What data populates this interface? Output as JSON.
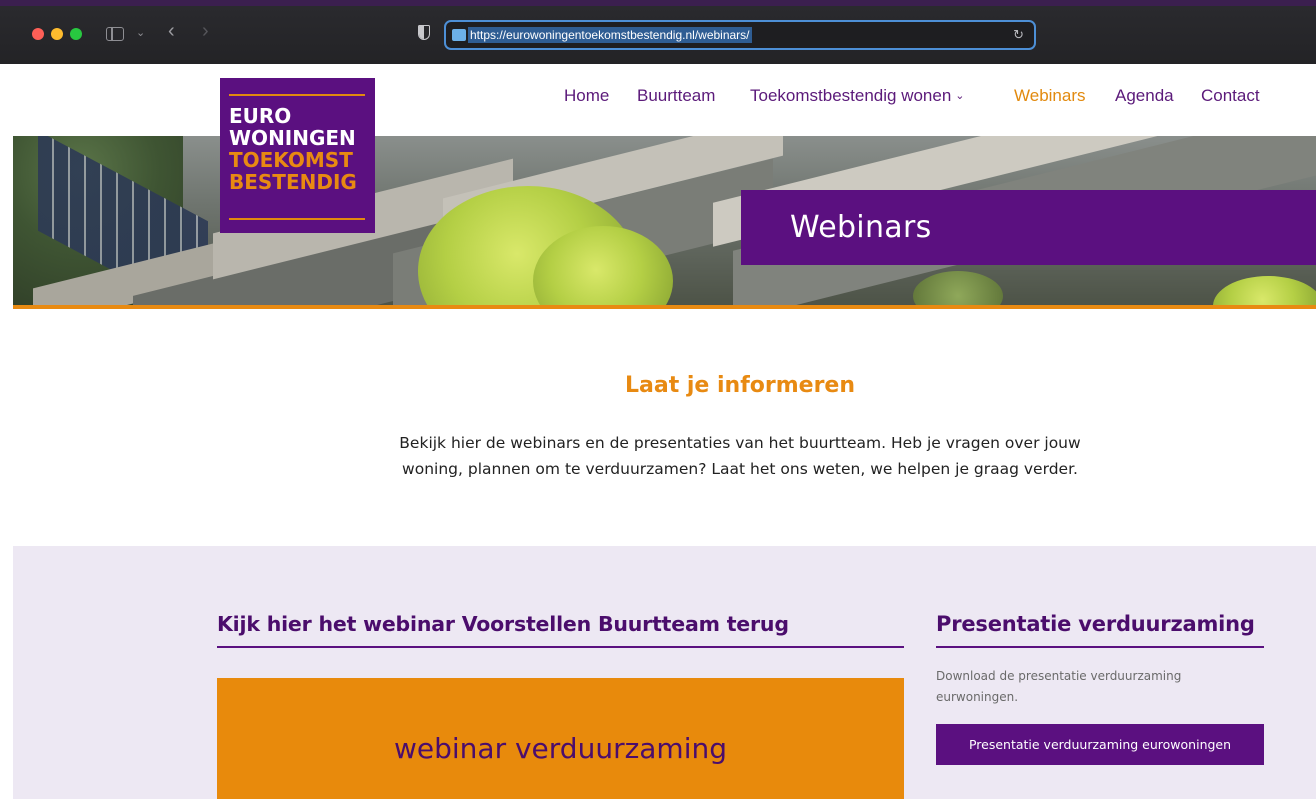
{
  "browser": {
    "url": "https://eurowoningentoekomstbestendig.nl/webinars/"
  },
  "logo": {
    "line1": "EURO",
    "line2": "WONINGEN",
    "line3": "TOEKOMST",
    "line4": "BESTENDIG"
  },
  "nav": {
    "items": [
      {
        "label": "Home"
      },
      {
        "label": "Buurtteam"
      },
      {
        "label": "Toekomstbestendig wonen"
      },
      {
        "label": "Webinars",
        "active": true
      },
      {
        "label": "Agenda"
      },
      {
        "label": "Contact"
      }
    ],
    "dropdown_chevron": "⌄"
  },
  "hero": {
    "title": "Webinars"
  },
  "intro": {
    "heading": "Laat je informeren",
    "text": "Bekijk hier de webinars en de presentaties van het buurtteam. Heb je vragen over jouw woning, plannen om te verduurzamen? Laat het ons weten, we helpen je graag verder."
  },
  "webinar_column": {
    "heading": "Kijk hier het webinar Voorstellen Buurtteam terug",
    "video_title": "webinar verduurzaming"
  },
  "presentation_column": {
    "heading": "Presentatie verduurzaming",
    "text": "Download de presentatie verduurzaming eurwoningen.",
    "button_label": "Presentatie verduurzaming eurowoningen"
  },
  "colors": {
    "brand_purple": "#5b1080",
    "brand_orange": "#e88a12",
    "lavender_bg": "#ede8f3"
  }
}
